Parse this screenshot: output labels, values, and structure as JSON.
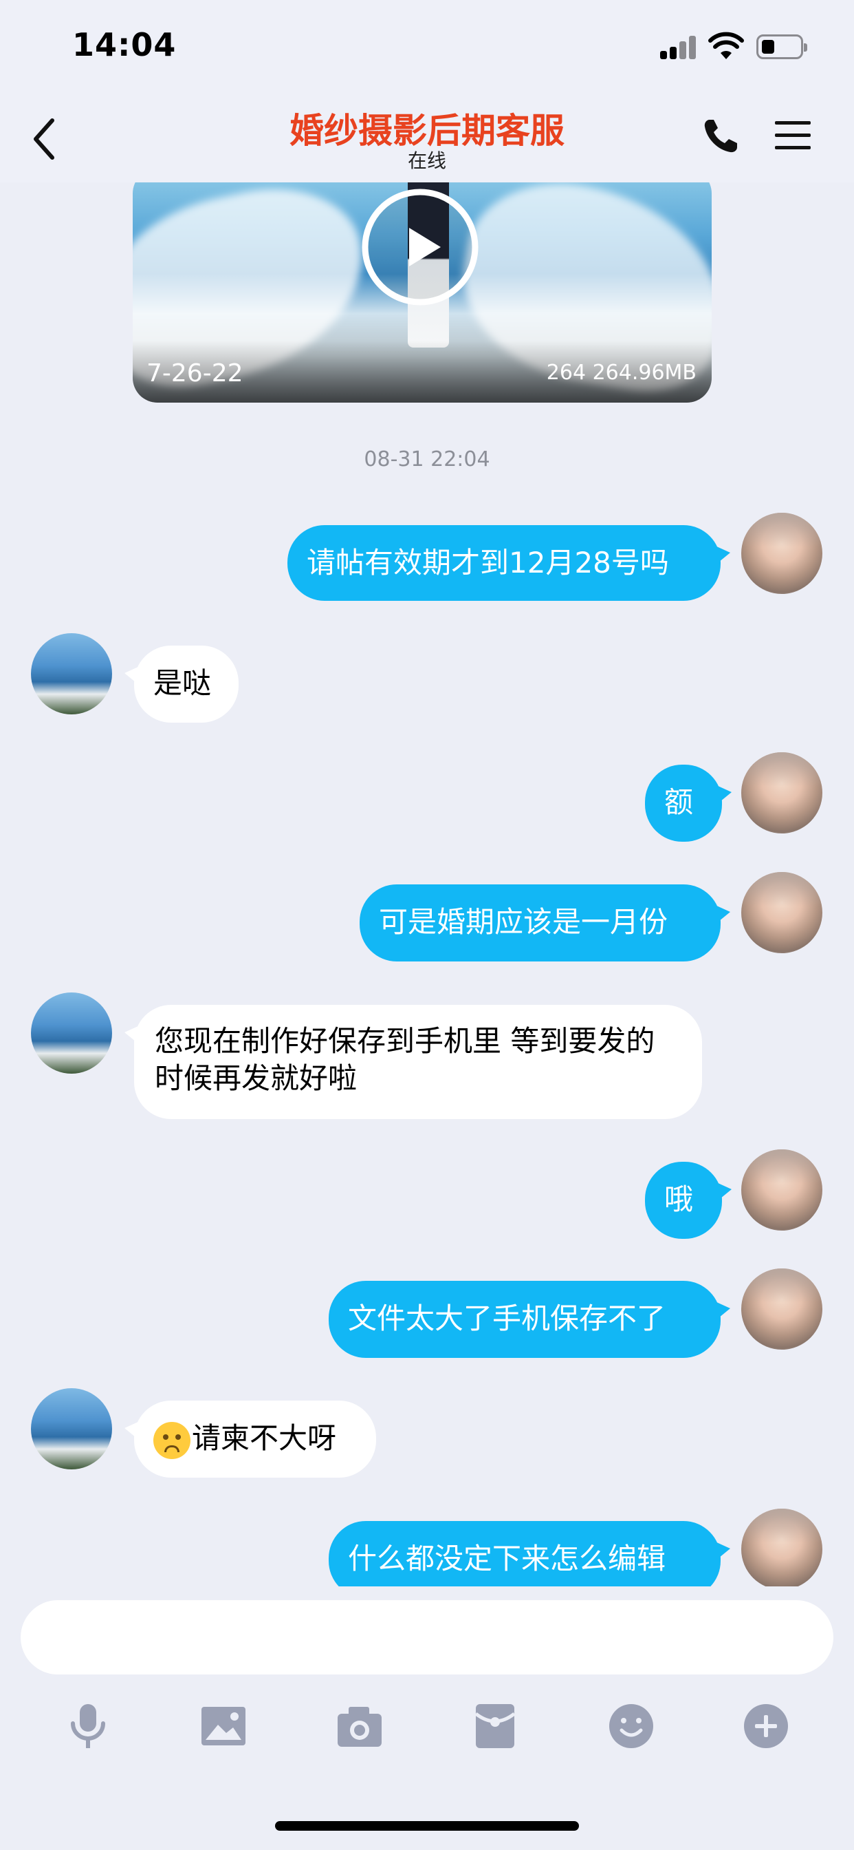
{
  "status_bar": {
    "time": "14:04",
    "battery_level": 0.35
  },
  "nav": {
    "title": "婚纱摄影后期客服",
    "subtitle": "在线",
    "back_icon": "chevron-left-icon",
    "phone_icon": "phone-icon",
    "menu_icon": "hamburger-menu-icon"
  },
  "video_card": {
    "date_text": "7-26-22",
    "size_text": "264 264.96MB",
    "play_icon": "play-circle-icon"
  },
  "timestamp": "08-31 22:04",
  "messages": [
    {
      "from": "me",
      "text": "请帖有效期才到12月28号吗"
    },
    {
      "from": "cs",
      "text": "是哒"
    },
    {
      "from": "me",
      "text": "额"
    },
    {
      "from": "me",
      "text": "可是婚期应该是一月份"
    },
    {
      "from": "cs",
      "text": "您现在制作好保存到手机里  等到要发的时候再发就好啦"
    },
    {
      "from": "me",
      "text": "哦"
    },
    {
      "from": "me",
      "text": "文件太大了手机保存不了"
    },
    {
      "from": "cs",
      "text": "请柬不大呀",
      "emoji": "pouting-face-emoji"
    },
    {
      "from": "me",
      "text": "什么都没定下来怎么编辑"
    }
  ],
  "input": {
    "value": "",
    "placeholder": ""
  },
  "toolbar": {
    "icons": [
      "microphone-icon",
      "image-icon",
      "camera-icon",
      "red-packet-icon",
      "smiley-icon",
      "plus-circle-icon"
    ]
  },
  "colors": {
    "accent": "#12b7f5",
    "title": "#e8421f",
    "background": "#eceef6"
  }
}
